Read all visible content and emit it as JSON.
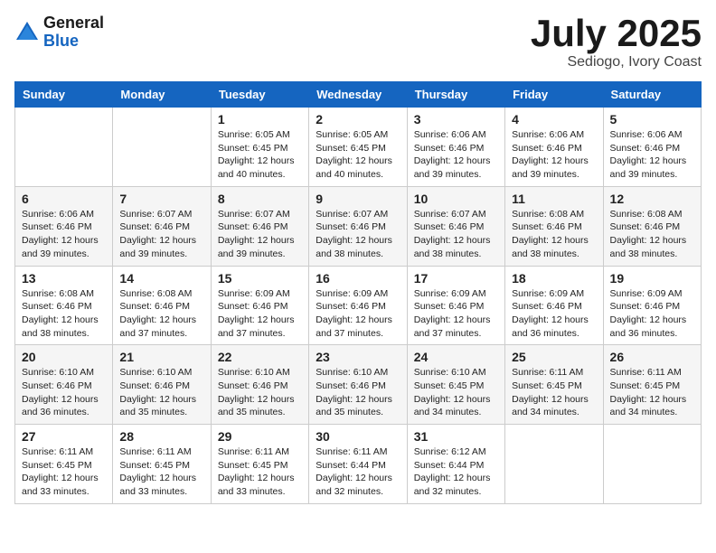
{
  "logo": {
    "general": "General",
    "blue": "Blue"
  },
  "title": {
    "month_year": "July 2025",
    "location": "Sediogo, Ivory Coast"
  },
  "weekdays": [
    "Sunday",
    "Monday",
    "Tuesday",
    "Wednesday",
    "Thursday",
    "Friday",
    "Saturday"
  ],
  "weeks": [
    [
      {
        "day": "",
        "sunrise": "",
        "sunset": "",
        "daylight": ""
      },
      {
        "day": "",
        "sunrise": "",
        "sunset": "",
        "daylight": ""
      },
      {
        "day": "1",
        "sunrise": "Sunrise: 6:05 AM",
        "sunset": "Sunset: 6:45 PM",
        "daylight": "Daylight: 12 hours and 40 minutes."
      },
      {
        "day": "2",
        "sunrise": "Sunrise: 6:05 AM",
        "sunset": "Sunset: 6:45 PM",
        "daylight": "Daylight: 12 hours and 40 minutes."
      },
      {
        "day": "3",
        "sunrise": "Sunrise: 6:06 AM",
        "sunset": "Sunset: 6:46 PM",
        "daylight": "Daylight: 12 hours and 39 minutes."
      },
      {
        "day": "4",
        "sunrise": "Sunrise: 6:06 AM",
        "sunset": "Sunset: 6:46 PM",
        "daylight": "Daylight: 12 hours and 39 minutes."
      },
      {
        "day": "5",
        "sunrise": "Sunrise: 6:06 AM",
        "sunset": "Sunset: 6:46 PM",
        "daylight": "Daylight: 12 hours and 39 minutes."
      }
    ],
    [
      {
        "day": "6",
        "sunrise": "Sunrise: 6:06 AM",
        "sunset": "Sunset: 6:46 PM",
        "daylight": "Daylight: 12 hours and 39 minutes."
      },
      {
        "day": "7",
        "sunrise": "Sunrise: 6:07 AM",
        "sunset": "Sunset: 6:46 PM",
        "daylight": "Daylight: 12 hours and 39 minutes."
      },
      {
        "day": "8",
        "sunrise": "Sunrise: 6:07 AM",
        "sunset": "Sunset: 6:46 PM",
        "daylight": "Daylight: 12 hours and 39 minutes."
      },
      {
        "day": "9",
        "sunrise": "Sunrise: 6:07 AM",
        "sunset": "Sunset: 6:46 PM",
        "daylight": "Daylight: 12 hours and 38 minutes."
      },
      {
        "day": "10",
        "sunrise": "Sunrise: 6:07 AM",
        "sunset": "Sunset: 6:46 PM",
        "daylight": "Daylight: 12 hours and 38 minutes."
      },
      {
        "day": "11",
        "sunrise": "Sunrise: 6:08 AM",
        "sunset": "Sunset: 6:46 PM",
        "daylight": "Daylight: 12 hours and 38 minutes."
      },
      {
        "day": "12",
        "sunrise": "Sunrise: 6:08 AM",
        "sunset": "Sunset: 6:46 PM",
        "daylight": "Daylight: 12 hours and 38 minutes."
      }
    ],
    [
      {
        "day": "13",
        "sunrise": "Sunrise: 6:08 AM",
        "sunset": "Sunset: 6:46 PM",
        "daylight": "Daylight: 12 hours and 38 minutes."
      },
      {
        "day": "14",
        "sunrise": "Sunrise: 6:08 AM",
        "sunset": "Sunset: 6:46 PM",
        "daylight": "Daylight: 12 hours and 37 minutes."
      },
      {
        "day": "15",
        "sunrise": "Sunrise: 6:09 AM",
        "sunset": "Sunset: 6:46 PM",
        "daylight": "Daylight: 12 hours and 37 minutes."
      },
      {
        "day": "16",
        "sunrise": "Sunrise: 6:09 AM",
        "sunset": "Sunset: 6:46 PM",
        "daylight": "Daylight: 12 hours and 37 minutes."
      },
      {
        "day": "17",
        "sunrise": "Sunrise: 6:09 AM",
        "sunset": "Sunset: 6:46 PM",
        "daylight": "Daylight: 12 hours and 37 minutes."
      },
      {
        "day": "18",
        "sunrise": "Sunrise: 6:09 AM",
        "sunset": "Sunset: 6:46 PM",
        "daylight": "Daylight: 12 hours and 36 minutes."
      },
      {
        "day": "19",
        "sunrise": "Sunrise: 6:09 AM",
        "sunset": "Sunset: 6:46 PM",
        "daylight": "Daylight: 12 hours and 36 minutes."
      }
    ],
    [
      {
        "day": "20",
        "sunrise": "Sunrise: 6:10 AM",
        "sunset": "Sunset: 6:46 PM",
        "daylight": "Daylight: 12 hours and 36 minutes."
      },
      {
        "day": "21",
        "sunrise": "Sunrise: 6:10 AM",
        "sunset": "Sunset: 6:46 PM",
        "daylight": "Daylight: 12 hours and 35 minutes."
      },
      {
        "day": "22",
        "sunrise": "Sunrise: 6:10 AM",
        "sunset": "Sunset: 6:46 PM",
        "daylight": "Daylight: 12 hours and 35 minutes."
      },
      {
        "day": "23",
        "sunrise": "Sunrise: 6:10 AM",
        "sunset": "Sunset: 6:46 PM",
        "daylight": "Daylight: 12 hours and 35 minutes."
      },
      {
        "day": "24",
        "sunrise": "Sunrise: 6:10 AM",
        "sunset": "Sunset: 6:45 PM",
        "daylight": "Daylight: 12 hours and 34 minutes."
      },
      {
        "day": "25",
        "sunrise": "Sunrise: 6:11 AM",
        "sunset": "Sunset: 6:45 PM",
        "daylight": "Daylight: 12 hours and 34 minutes."
      },
      {
        "day": "26",
        "sunrise": "Sunrise: 6:11 AM",
        "sunset": "Sunset: 6:45 PM",
        "daylight": "Daylight: 12 hours and 34 minutes."
      }
    ],
    [
      {
        "day": "27",
        "sunrise": "Sunrise: 6:11 AM",
        "sunset": "Sunset: 6:45 PM",
        "daylight": "Daylight: 12 hours and 33 minutes."
      },
      {
        "day": "28",
        "sunrise": "Sunrise: 6:11 AM",
        "sunset": "Sunset: 6:45 PM",
        "daylight": "Daylight: 12 hours and 33 minutes."
      },
      {
        "day": "29",
        "sunrise": "Sunrise: 6:11 AM",
        "sunset": "Sunset: 6:45 PM",
        "daylight": "Daylight: 12 hours and 33 minutes."
      },
      {
        "day": "30",
        "sunrise": "Sunrise: 6:11 AM",
        "sunset": "Sunset: 6:44 PM",
        "daylight": "Daylight: 12 hours and 32 minutes."
      },
      {
        "day": "31",
        "sunrise": "Sunrise: 6:12 AM",
        "sunset": "Sunset: 6:44 PM",
        "daylight": "Daylight: 12 hours and 32 minutes."
      },
      {
        "day": "",
        "sunrise": "",
        "sunset": "",
        "daylight": ""
      },
      {
        "day": "",
        "sunrise": "",
        "sunset": "",
        "daylight": ""
      }
    ]
  ]
}
